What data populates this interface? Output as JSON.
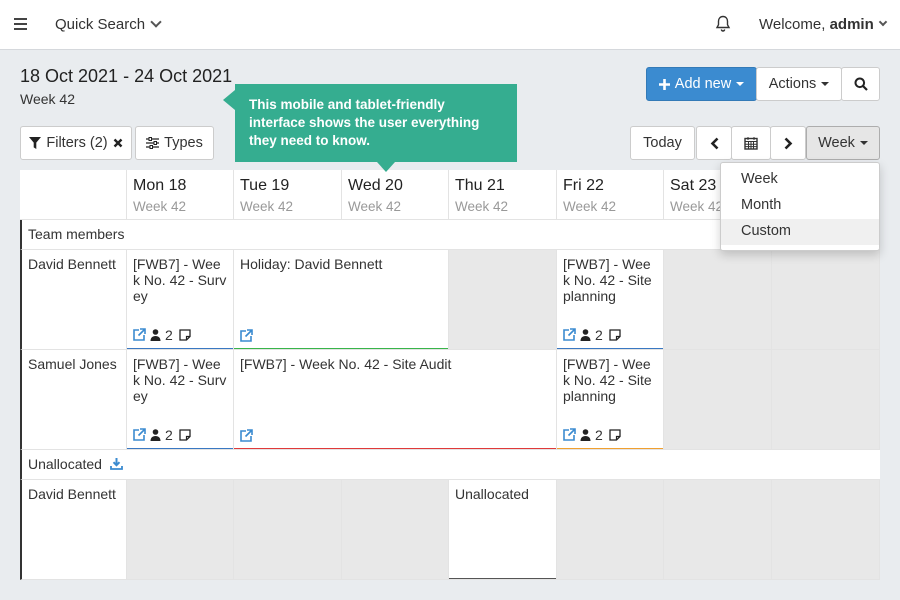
{
  "header": {
    "quick_search_label": "Quick Search",
    "welcome_prefix": "Welcome, ",
    "welcome_user": "admin"
  },
  "period": {
    "date_range": "18 Oct 2021 - 24 Oct 2021",
    "week_label": "Week 42"
  },
  "toolbar": {
    "add_new_label": "Add new",
    "actions_label": "Actions",
    "filters_label": "Filters (2)",
    "types_label": "Types",
    "today_label": "Today",
    "view_label": "Week"
  },
  "tooltip": {
    "text": "This mobile and tablet-friendly interface shows the user everything they need to know."
  },
  "view_menu": {
    "options": [
      "Week",
      "Month",
      "Custom"
    ],
    "highlighted": "Custom"
  },
  "calendar": {
    "days": [
      {
        "name": "Mon 18",
        "week": "Week 42"
      },
      {
        "name": "Tue 19",
        "week": "Week 42"
      },
      {
        "name": "Wed 20",
        "week": "Week 42"
      },
      {
        "name": "Thu 21",
        "week": "Week 42"
      },
      {
        "name": "Fri 22",
        "week": "Week 42"
      },
      {
        "name": "Sat 23",
        "week": "Week 42"
      }
    ],
    "groups": {
      "team_members": "Team members",
      "unallocated": "Unallocated"
    },
    "rows": [
      {
        "name": "David Bennett"
      },
      {
        "name": "Samuel Jones"
      },
      {
        "name": "David Bennett"
      }
    ],
    "events": [
      {
        "title": "[FWB7] - Week No. 42 - Survey",
        "people": "2",
        "color": "#3a78c2"
      },
      {
        "title": "Holiday: David Bennett",
        "people": "",
        "color": "#39b54a"
      },
      {
        "title": "[FWB7] - Week No. 42 - Site planning",
        "people": "2",
        "color": "#3a78c2"
      },
      {
        "title": "[FWB7] - Week No. 42 - Survey",
        "people": "2",
        "color": "#3a78c2"
      },
      {
        "title": "[FWB7] - Week No. 42 - Site Audit",
        "people": "",
        "color": "#e03a3a"
      },
      {
        "title": "[FWB7] - Week No. 42 - Site planning",
        "people": "2",
        "color": "#f0a030"
      },
      {
        "title": "Unallocated",
        "people": "",
        "color": "#555555"
      }
    ]
  }
}
